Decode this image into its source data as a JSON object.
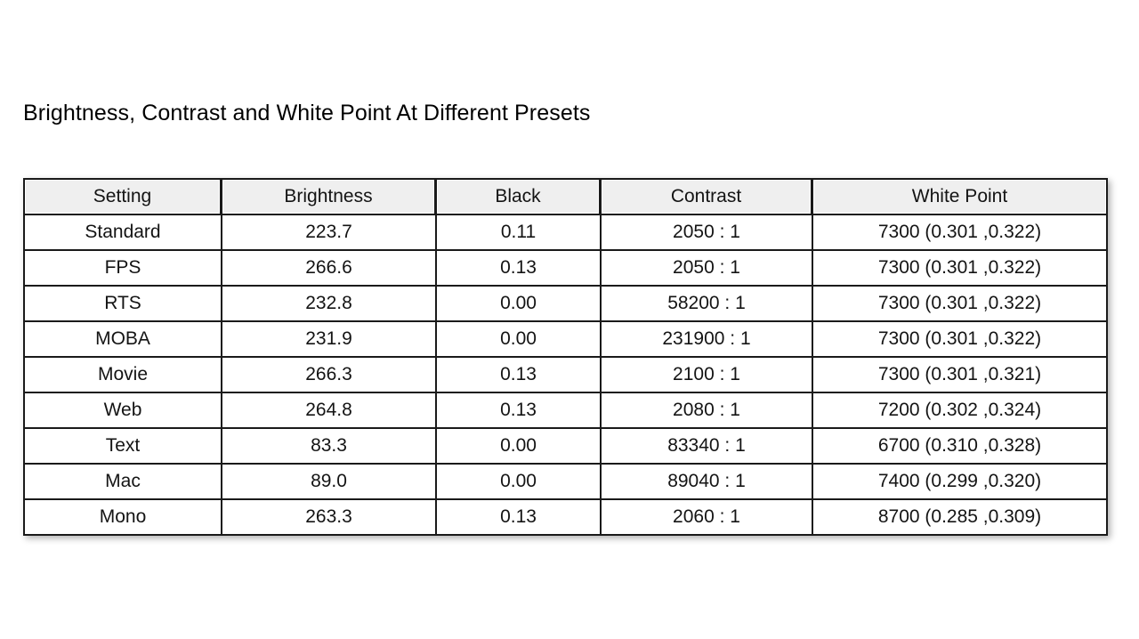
{
  "chart_data": {
    "type": "table",
    "title": "Brightness, Contrast and White Point At Different Presets",
    "columns": [
      "Setting",
      "Brightness",
      "Black",
      "Contrast",
      "White Point"
    ],
    "rows": [
      [
        "Standard",
        "223.7",
        "0.11",
        "2050 : 1",
        "7300 (0.301 ,0.322)"
      ],
      [
        "FPS",
        "266.6",
        "0.13",
        "2050 : 1",
        "7300 (0.301 ,0.322)"
      ],
      [
        "RTS",
        "232.8",
        "0.00",
        "58200 : 1",
        "7300 (0.301 ,0.322)"
      ],
      [
        "MOBA",
        "231.9",
        "0.00",
        "231900 : 1",
        "7300 (0.301 ,0.322)"
      ],
      [
        "Movie",
        "266.3",
        "0.13",
        "2100 : 1",
        "7300 (0.301 ,0.321)"
      ],
      [
        "Web",
        "264.8",
        "0.13",
        "2080 : 1",
        "7200 (0.302 ,0.324)"
      ],
      [
        "Text",
        "83.3",
        "0.00",
        "83340 : 1",
        "6700 (0.310 ,0.328)"
      ],
      [
        "Mac",
        "89.0",
        "0.00",
        "89040 : 1",
        "7400 (0.299 ,0.320)"
      ],
      [
        "Mono",
        "263.3",
        "0.13",
        "2060 : 1",
        "8700 (0.285 ,0.309)"
      ]
    ],
    "xlabel": "",
    "ylabel": "",
    "legend": [],
    "grid": true,
    "colors": {
      "page_background": "#ffffff",
      "header_background": "#efefef",
      "cell_background": "#ffffff",
      "border": "#1a1a1a",
      "text": "#141414",
      "title_text": "#000000"
    }
  }
}
